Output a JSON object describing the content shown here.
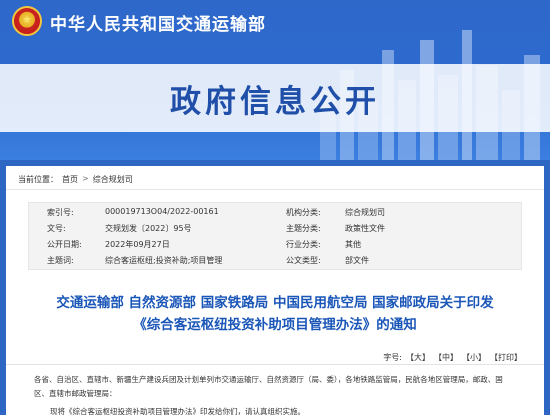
{
  "header": {
    "site_title": "中华人民共和国交通运输部",
    "banner_heading": "政府信息公开"
  },
  "breadcrumb": {
    "label": "当前位置：",
    "items": [
      "首页",
      "综合规划司"
    ],
    "separator": ">"
  },
  "meta": {
    "rows": [
      {
        "k1": "索引号:",
        "v1": "000019713O04/2022-00161",
        "k2": "机构分类:",
        "v2": "综合规划司"
      },
      {
        "k1": "文号:",
        "v1": "交规划发〔2022〕95号",
        "k2": "主题分类:",
        "v2": "政策性文件"
      },
      {
        "k1": "公开日期:",
        "v1": "2022年09月27日",
        "k2": "行业分类:",
        "v2": "其他"
      },
      {
        "k1": "主题词:",
        "v1": "综合客运枢纽;投资补助;项目管理",
        "k2": "公文类型:",
        "v2": "部文件"
      }
    ]
  },
  "document": {
    "title_line1": "交通运输部 自然资源部 国家铁路局 中国民用航空局 国家邮政局关于印发",
    "title_line2": "《综合客运枢纽投资补助项目管理办法》的通知"
  },
  "font_size": {
    "label": "字号:",
    "large": "【大】",
    "medium": "【中】",
    "small": "【小】",
    "print": "【打印】"
  },
  "body": {
    "line1": "各省、自治区、直辖市、新疆生产建设兵团及计划单列市交通运输厅、自然资源厅（局、委），各地铁路监管局，民航各地区管理局，邮政、国",
    "line2": "区、直辖市邮政管理局：",
    "line3": "现将《综合客运枢纽投资补助项目管理办法》印发给你们，请认真组织实施。"
  },
  "colors": {
    "banner_blue": "#2d66c3",
    "title_blue": "#1a56b8"
  }
}
